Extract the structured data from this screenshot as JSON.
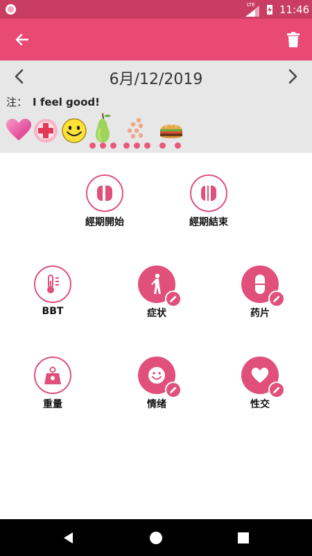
{
  "status_bar": {
    "time": "11:46",
    "network": "LTE"
  },
  "app_bar": {
    "back_icon": "arrow-back-icon",
    "delete_icon": "trash-icon"
  },
  "date_nav": {
    "date": "6月/12/2019"
  },
  "note": {
    "label": "注：",
    "value": "I feel good!"
  },
  "moods": [
    {
      "name": "heart",
      "glyph": "💗"
    },
    {
      "name": "medical",
      "glyph": "➕"
    },
    {
      "name": "happy-face",
      "glyph": "😊"
    },
    {
      "name": "pear",
      "glyph": "🍐"
    },
    {
      "name": "pills",
      "glyph": "•"
    },
    {
      "name": "burger",
      "glyph": "🍔"
    }
  ],
  "actions": {
    "period_start": "經期開始",
    "period_end": "經期結束",
    "bbt": "BBT",
    "symptoms": "症状",
    "pills": "药片",
    "weight": "重量",
    "mood": "情绪",
    "sex": "性交"
  },
  "colors": {
    "primary": "#e84a74",
    "status": "#c93d62",
    "accent": "#e0507a",
    "panel": "#e7e7e7"
  }
}
